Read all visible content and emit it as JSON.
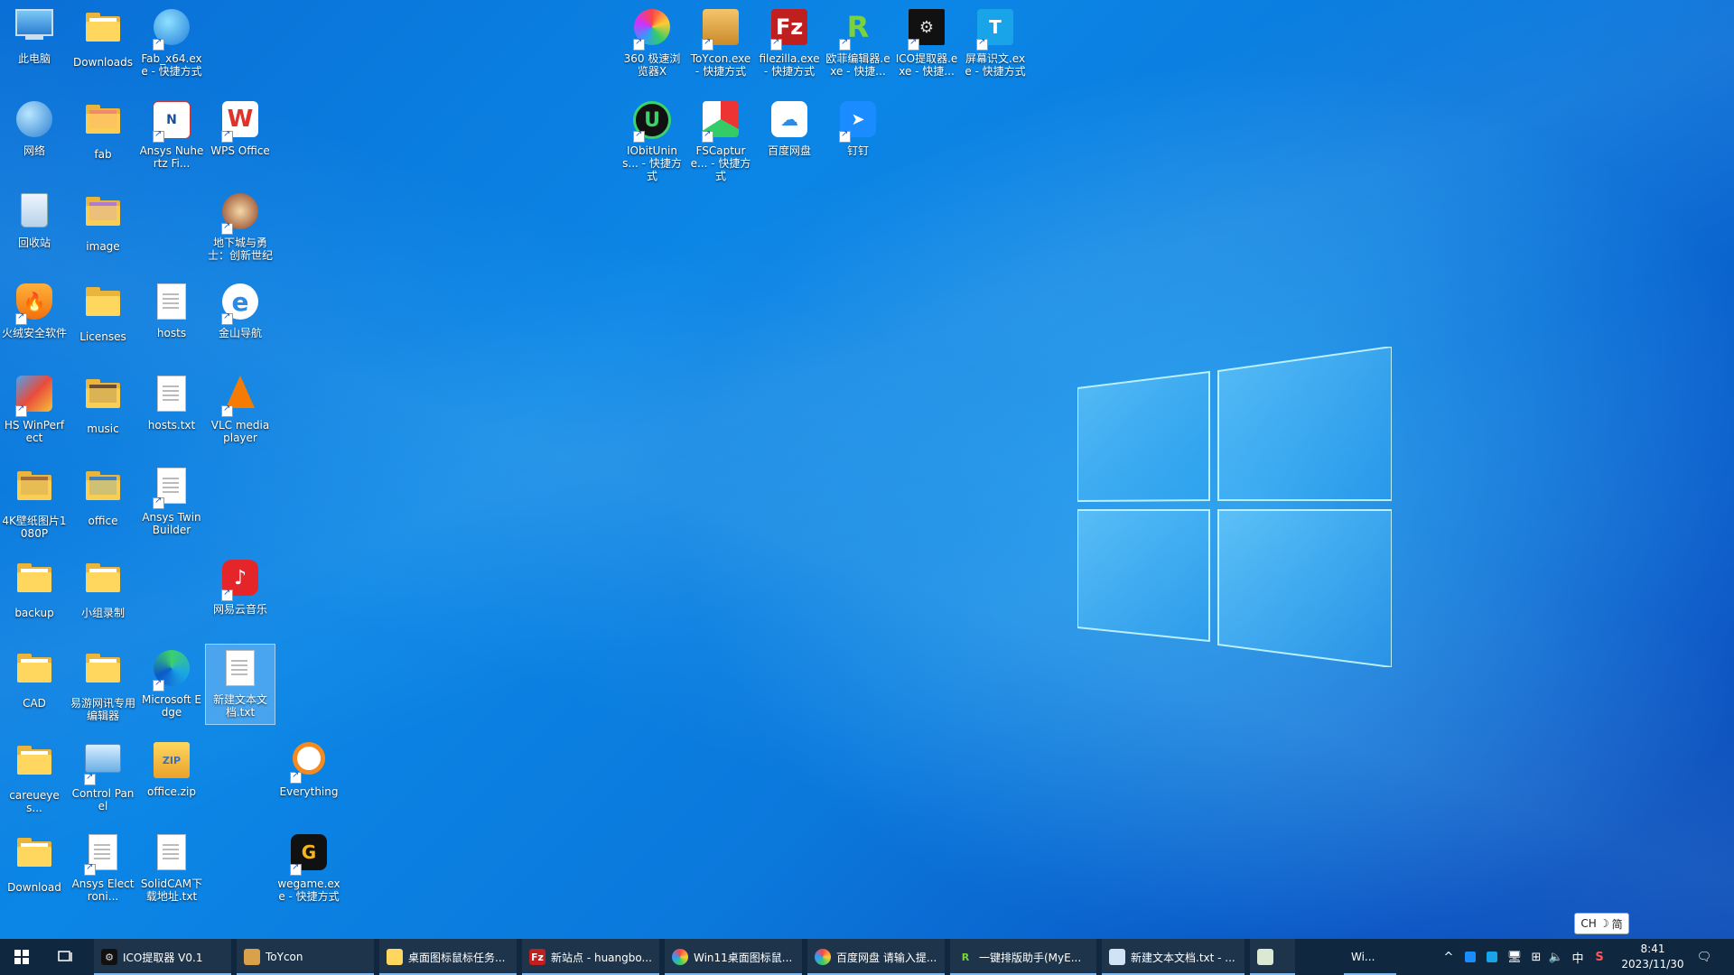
{
  "desktop": {
    "icons": {
      "this_pc": "此电脑",
      "downloads": "Downloads",
      "fab_exe": "Fab_x64.exe - 快捷方式",
      "network": "网络",
      "fab": "fab",
      "ansys_nuhertz": "Ansys Nuhertz Fi...",
      "wps": "WPS Office",
      "recycle": "回收站",
      "image": "image",
      "dungeon": "地下城与勇士：创新世纪",
      "huorong": "火绒安全软件",
      "licenses": "Licenses",
      "hosts": "hosts",
      "jinshan": "金山导航",
      "hs_winperfect": "HS WinPerfect",
      "music": "music",
      "hosts_txt": "hosts.txt",
      "vlc": "VLC media player",
      "wallpaper4k": "4K壁纸图片1080P",
      "office": "office",
      "ansys_twin": "Ansys Twin Builder",
      "backup": "backup",
      "xiaozu": "小组录制",
      "netease_music": "网易云音乐",
      "cad": "CAD",
      "yiyou": "易游网讯专用编辑器",
      "edge": "Microsoft Edge",
      "new_txt": "新建文本文档.txt",
      "careueyes": "careueyes...",
      "control_panel": "Control Panel",
      "office_zip": "office.zip",
      "everything": "Everything",
      "download": "Download",
      "ansys_electronic": "Ansys Electroni...",
      "solidcam": "SolidCAM下载地址.txt",
      "wegame": "wegame.exe - 快捷方式",
      "b360": "360 极速浏览器X",
      "toycon": "ToYcon.exe - 快捷方式",
      "filezilla": "filezilla.exe - 快捷方式",
      "oufei": "欧菲编辑器.exe - 快捷...",
      "ico_extract": "ICO提取器.exe - 快捷...",
      "ocr": "屏幕识文.exe - 快捷方式",
      "iobit": "IObitUnins... - 快捷方式",
      "fscapture": "FSCapture... - 快捷方式",
      "baidu": "百度网盘",
      "dingding": "钉钉"
    }
  },
  "taskbar": {
    "apps": [
      {
        "label": "ICO提取器 V0.1"
      },
      {
        "label": "ToYcon"
      },
      {
        "label": "桌面图标鼠标任务..."
      },
      {
        "label": "新站点 - huangbo..."
      },
      {
        "label": "Win11桌面图标鼠..."
      },
      {
        "label": "百度网盘 请输入提..."
      },
      {
        "label": "一键排版助手(MyE..."
      },
      {
        "label": "新建文本文档.txt - ..."
      },
      {
        "label": ""
      },
      {
        "label": "Wi..."
      }
    ],
    "tray": {
      "ime": "中",
      "caret": "^"
    },
    "clock": {
      "time": "8:41",
      "date": "2023/11/30"
    },
    "ime_bar": {
      "lang": "CH",
      "mode": "简"
    }
  },
  "colors": {
    "desktop_blue": "#0b86e6",
    "taskbar": "#10283f",
    "folder": "#ffd75e"
  }
}
